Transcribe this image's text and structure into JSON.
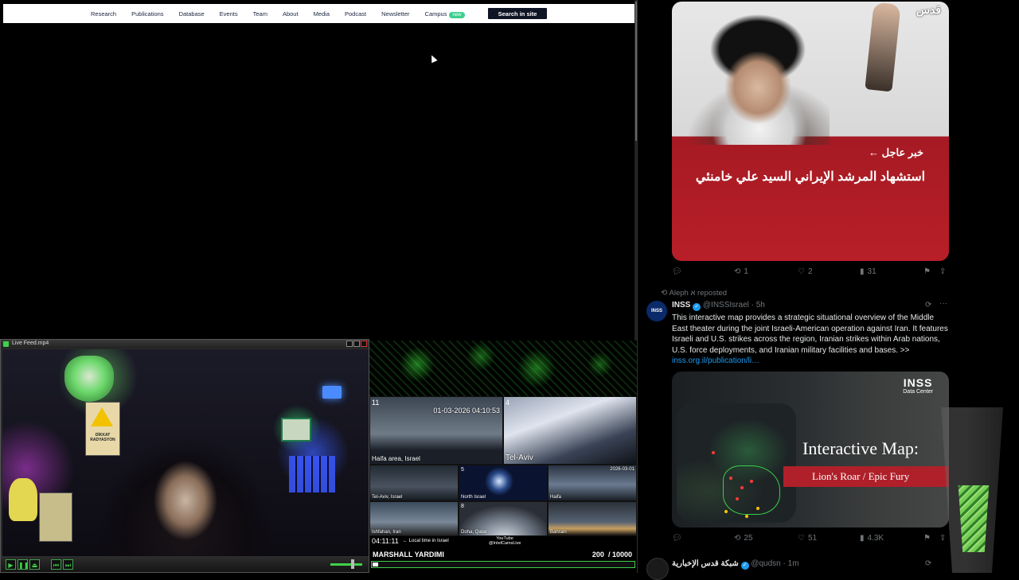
{
  "left_browser": {
    "nav_items": [
      "Research",
      "Publications",
      "Database",
      "Events",
      "Team",
      "About",
      "Media",
      "Podcast",
      "Newsletter",
      "Campus"
    ],
    "campus_badge": "new",
    "search_button": "Search in site"
  },
  "player": {
    "title": "Live Feed.mp4",
    "controls": [
      "play-icon",
      "pause-icon",
      "eject-icon",
      "prev-icon",
      "next-icon"
    ]
  },
  "cameras": {
    "cam1_num": "11",
    "cam1_time": "01-03-2026 04:10:53",
    "cam1_label": "Haifa area, Israel",
    "cam2_num": "4",
    "cam2_label": "Tel-Aviv",
    "cam3_label": "Tel-Aviv, Israel",
    "cam4_num": "5",
    "cam4_label": "North Israel",
    "cam5_time": "2026-03-01",
    "cam5_label": "Haifa",
    "cam6_label": "Ishfahan, Iran",
    "cam7_num": "8",
    "cam7_label": "Doha, Qatar",
    "cam8_label": "Bahrain",
    "footer_time": "04:11:11",
    "footer_local": "← Local time in Israel",
    "footer_channel": "YouTube @IntelCamsLive",
    "ticker_name": "MARSHALL YARDIMI",
    "ticker_count": "200",
    "ticker_total": "/ 10000",
    "ticker_progress": 0.02
  },
  "feed": {
    "post1": {
      "logo": "قدس",
      "breaking": "خبر عاجل ←",
      "headline": "استشهاد المرشد الإيراني السيد علي خامنئي",
      "retweets": "1",
      "likes": "2",
      "views": "31"
    },
    "post2": {
      "repost_by": "Aleph א reposted",
      "name": "INSS",
      "handle": "@INSSIsrael",
      "time": "· 5h",
      "avatar_text": "INSS",
      "text": "This interactive map provides a strategic situational overview of the Middle East theater during the joint Israeli-American operation against Iran. It features Israeli and U.S. strikes across the region, Iranian strikes within Arab nations, U.S. force deployments, and Iranian military facilities and bases. >> ",
      "link": "inss.org.il/publication/li…",
      "card_logo": "INSS",
      "card_logo_sub": "Data Center",
      "card_title": "Interactive Map:",
      "card_subtitle": "Lion's Roar / Epic Fury",
      "retweets": "25",
      "likes": "51",
      "views": "4.3K"
    },
    "post3": {
      "name": "شبكة قدس الإخبارية",
      "handle": "@qudsn",
      "time": "· 1m"
    }
  },
  "colors": {
    "x_blue": "#1d9bf0",
    "breaking_red": "#b81f28",
    "player_green": "#3fd14a"
  }
}
